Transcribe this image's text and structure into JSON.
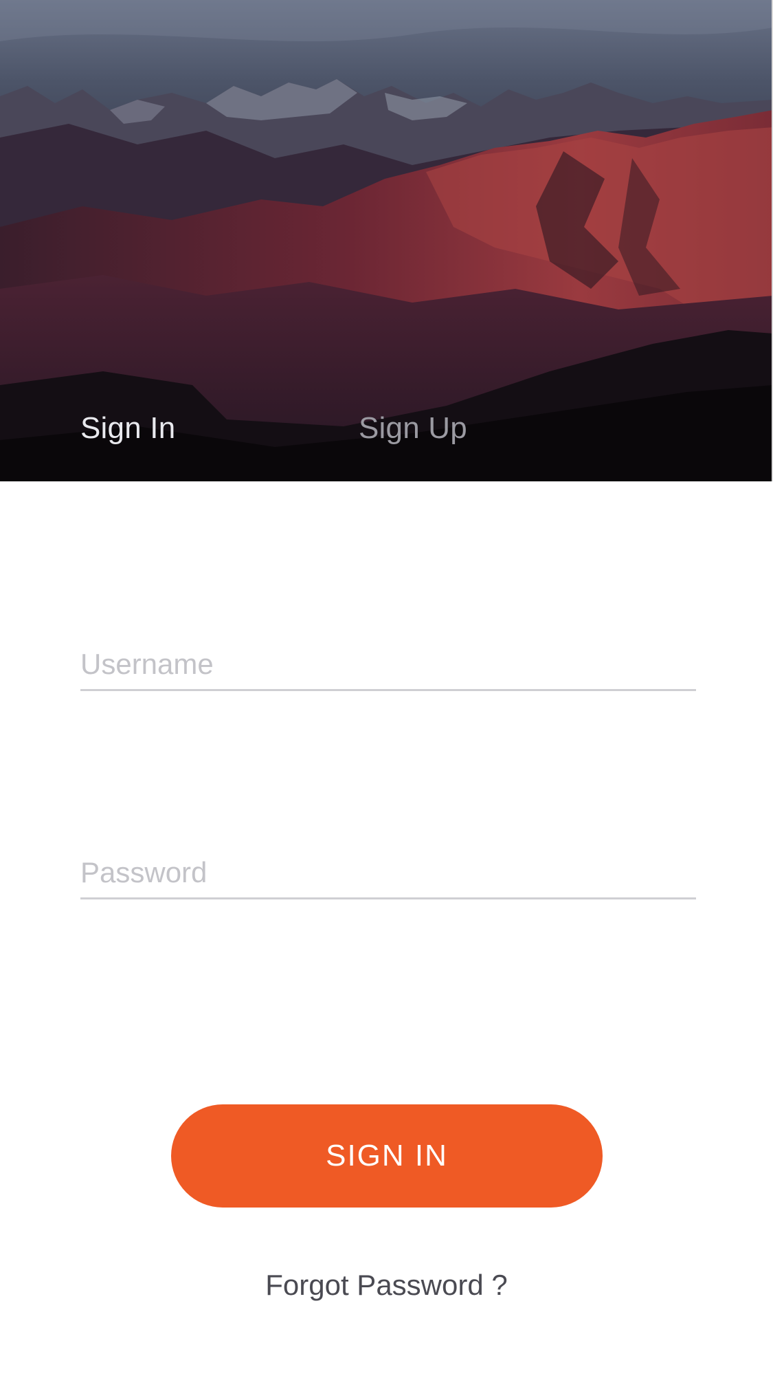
{
  "hero": {
    "image": "mountain-landscape-dusk",
    "tabs": {
      "sign_in": "Sign In",
      "sign_up": "Sign Up"
    }
  },
  "form": {
    "username": {
      "value": "",
      "placeholder": "Username"
    },
    "password": {
      "value": "",
      "placeholder": "Password"
    },
    "submit_label": "SIGN IN",
    "forgot_label": "Forgot Password ?"
  },
  "colors": {
    "accent": "#ef5a25",
    "active_tab": "#e9e9ee",
    "inactive_tab": "#9b9aa2",
    "placeholder": "#c3c3c8",
    "underline": "#cfcfd3"
  }
}
